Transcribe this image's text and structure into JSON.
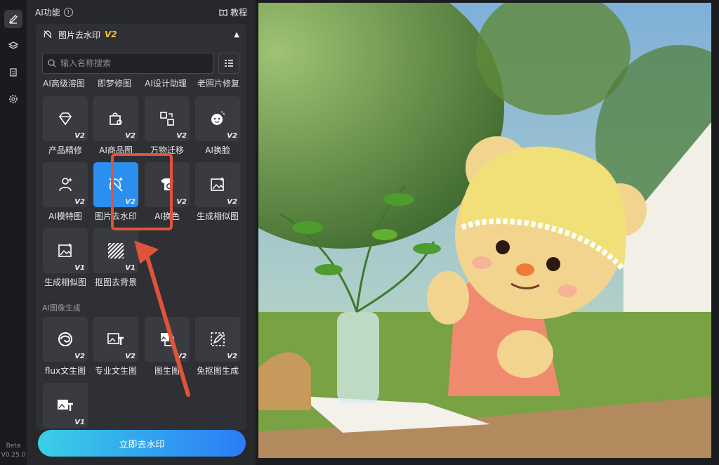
{
  "rail": {
    "beta": "Beta",
    "version": "V0.25.0"
  },
  "panel": {
    "title": "AI功能",
    "tutorial": "教程"
  },
  "tool": {
    "name": "图片去水印",
    "badge": "V2"
  },
  "search": {
    "placeholder": "输入名称搜索"
  },
  "top_labels": [
    "AI高级溶图",
    "即梦修图",
    "AI设计助理",
    "老照片修复"
  ],
  "rows": [
    [
      {
        "label": "产品精修",
        "ver": "V2",
        "icon": "gem-sparkle-icon"
      },
      {
        "label": "AI商品图",
        "ver": "V2",
        "icon": "bag-sparkle-icon"
      },
      {
        "label": "万物迁移",
        "ver": "V2",
        "icon": "transfer-icon"
      },
      {
        "label": "AI换脸",
        "ver": "V2",
        "icon": "face-swap-icon"
      }
    ],
    [
      {
        "label": "AI模特图",
        "ver": "V2",
        "icon": "model-sparkle-icon"
      },
      {
        "label": "图片去水印",
        "ver": "V2",
        "icon": "remove-watermark-icon"
      },
      {
        "label": "AI换色",
        "ver": "V2",
        "icon": "palette-tshirt-icon"
      },
      {
        "label": "生成相似图",
        "ver": "V2",
        "icon": "image-sparkle-icon"
      }
    ],
    [
      {
        "label": "生成相似图",
        "ver": "V1",
        "icon": "image-sparkle-icon"
      },
      {
        "label": "抠图去背景",
        "ver": "V1",
        "icon": "cutout-pattern-icon"
      }
    ]
  ],
  "section2": "AI图像生成",
  "rows2": [
    [
      {
        "label": "flux文生图",
        "ver": "V2",
        "icon": "flux-swirl-icon"
      },
      {
        "label": "专业文生图",
        "ver": "V2",
        "icon": "image-text-icon"
      },
      {
        "label": "图生图",
        "ver": "V2",
        "icon": "image-to-image-icon"
      },
      {
        "label": "免抠图生成",
        "ver": "V2",
        "icon": "edit-image-icon"
      }
    ],
    [
      {
        "label": "",
        "ver": "V1",
        "icon": "image-text-icon"
      }
    ]
  ],
  "cta": "立即去水印",
  "colors": {
    "accent": "#2b8ff0",
    "highlight": "#e0533a",
    "badge": "#f1c232"
  }
}
